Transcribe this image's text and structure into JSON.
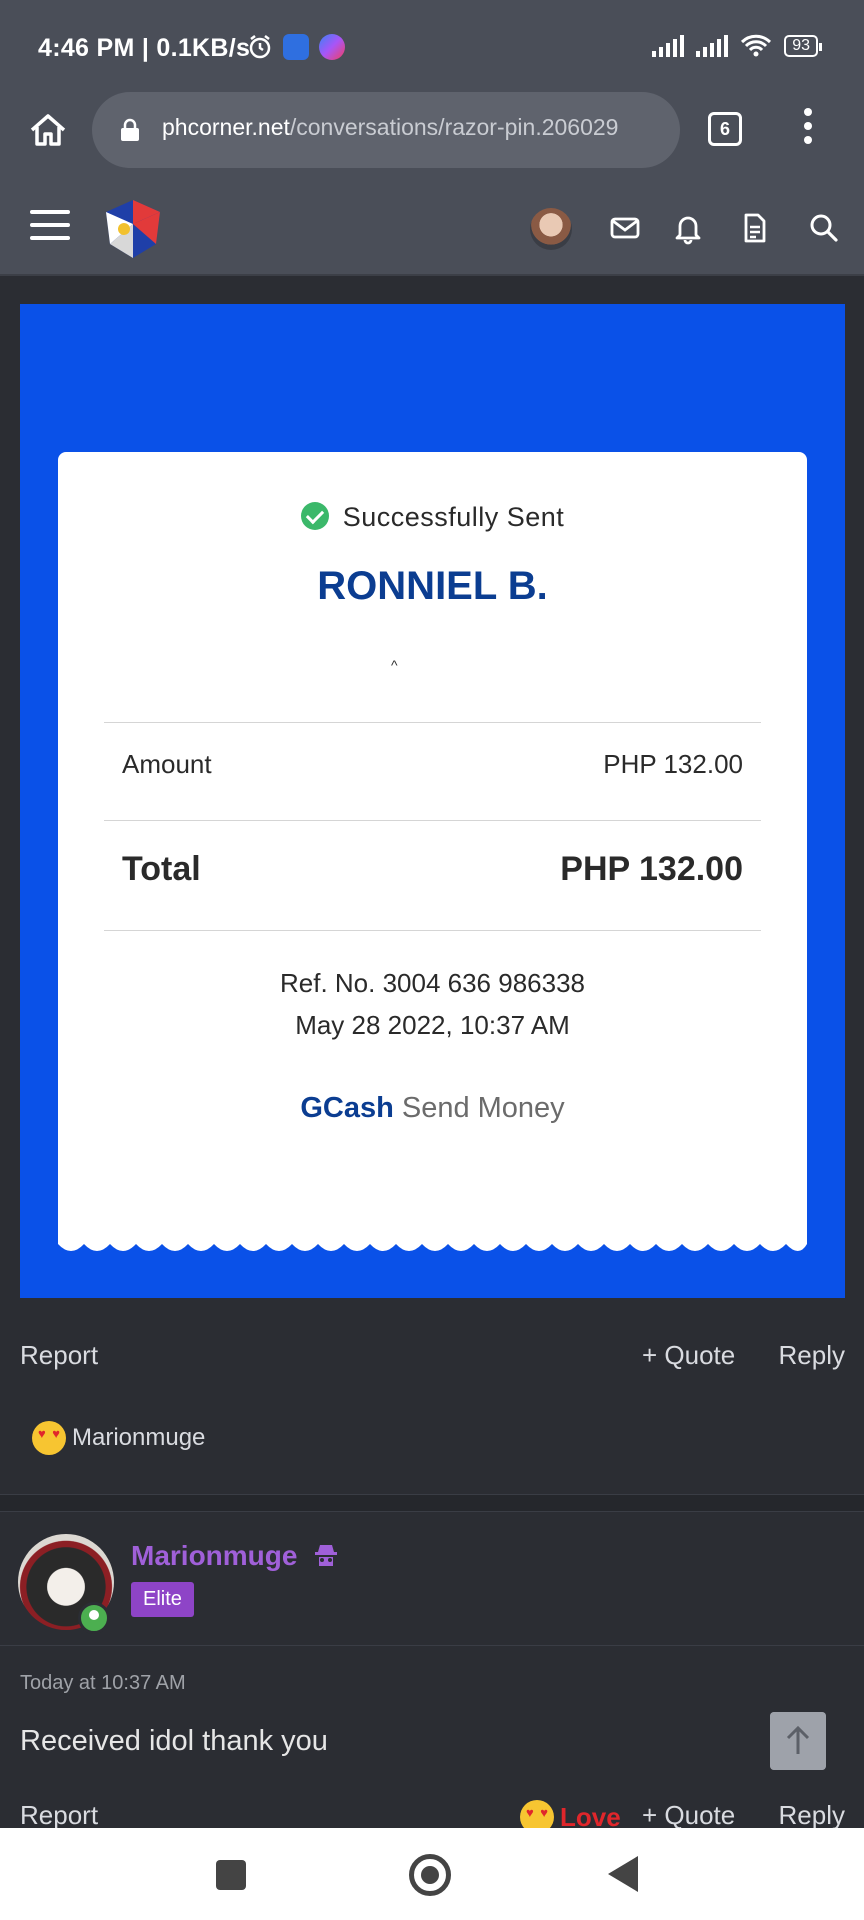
{
  "status_bar": {
    "time": "4:46 PM | 0.1KB/s",
    "battery": "93",
    "icons": [
      "alarm-icon",
      "message-app-icon",
      "messenger-icon",
      "signal-icon",
      "signal-icon",
      "wifi-icon",
      "battery-icon"
    ]
  },
  "browser": {
    "url_host": "phcorner.net",
    "url_path": "/conversations/razor-pin.206029",
    "tab_count": "6"
  },
  "receipt": {
    "status": "Successfully Sent",
    "recipient": "RONNIEL B.",
    "amount_label": "Amount",
    "amount_value": "PHP 132.00",
    "total_label": "Total",
    "total_value": "PHP 132.00",
    "ref": "Ref. No. 3004 636 986338",
    "date": "May 28 2022, 10:37 AM",
    "brand_name": "GCash",
    "brand_action": "Send Money"
  },
  "post_actions": {
    "report": "Report",
    "quote": "+ Quote",
    "reply": "Reply"
  },
  "reactions": {
    "user": "Marionmuge"
  },
  "message": {
    "username": "Marionmuge",
    "badge": "Elite",
    "time": "Today at 10:37 AM",
    "text": "Received idol thank you",
    "report": "Report",
    "love": "Love",
    "quote": "+ Quote",
    "reply": "Reply"
  },
  "colors": {
    "receipt_bg": "#0a51e8",
    "gcash_blue": "#0b3d91",
    "username_purple": "#a060d9",
    "love_red": "#e0262b"
  }
}
